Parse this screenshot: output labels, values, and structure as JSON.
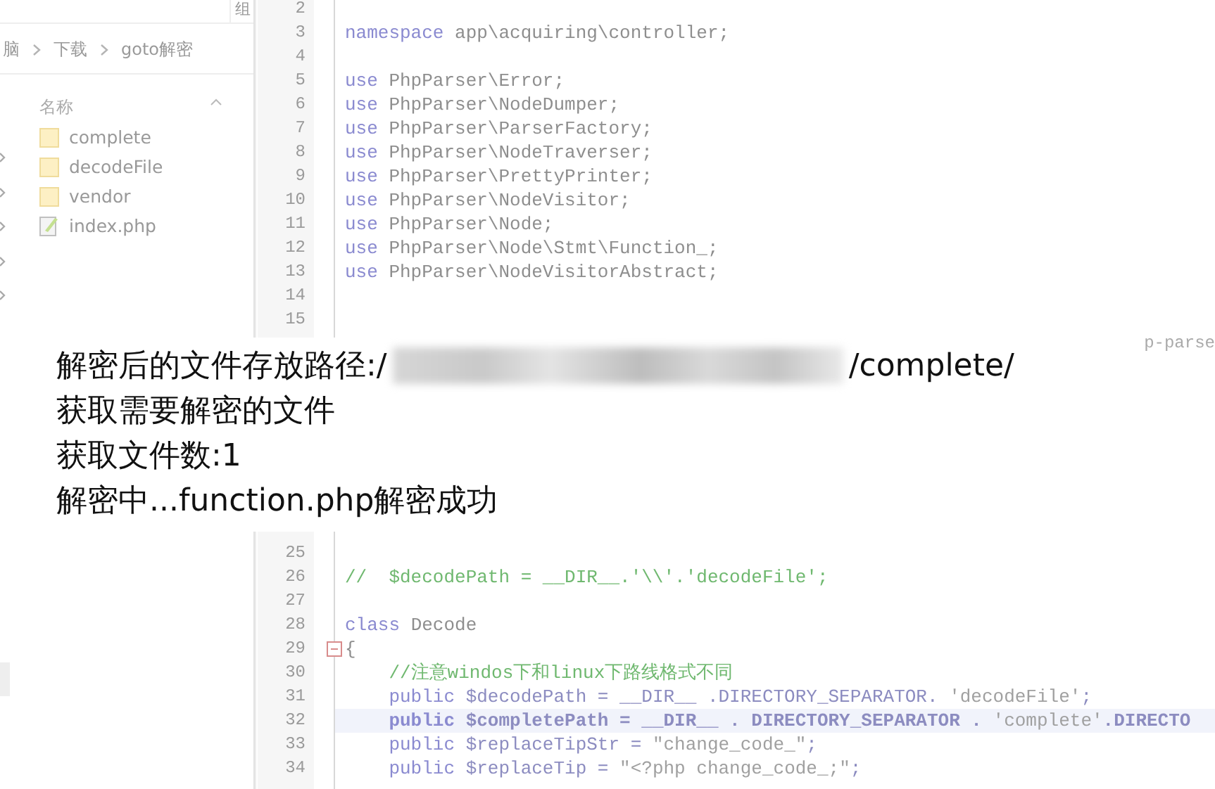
{
  "explorer": {
    "column_fragment": "组",
    "breadcrumb": [
      "脑",
      "下载",
      "goto解密"
    ],
    "column": "名称",
    "files": [
      {
        "name": "complete",
        "kind": "folder"
      },
      {
        "name": "decodeFile",
        "kind": "folder"
      },
      {
        "name": "vendor",
        "kind": "folder"
      },
      {
        "name": "index.php",
        "kind": "php"
      }
    ]
  },
  "editor": {
    "top_lines": [
      {
        "number": "2",
        "current": false,
        "fold": false
      },
      {
        "number": "3",
        "current": false,
        "fold": false,
        "tokens": [
          {
            "kind": "kw",
            "text": "namespace"
          },
          {
            "kind": "plain",
            "text": " app\\acquiring\\controller;"
          }
        ]
      },
      {
        "number": "4",
        "current": false,
        "fold": false
      },
      {
        "number": "5",
        "current": false,
        "fold": false,
        "tokens": [
          {
            "kind": "kw",
            "text": "use"
          },
          {
            "kind": "plain",
            "text": " PhpParser\\Error;"
          }
        ]
      },
      {
        "number": "6",
        "current": false,
        "fold": false,
        "tokens": [
          {
            "kind": "kw",
            "text": "use"
          },
          {
            "kind": "plain",
            "text": " PhpParser\\NodeDumper;"
          }
        ]
      },
      {
        "number": "7",
        "current": false,
        "fold": false,
        "tokens": [
          {
            "kind": "kw",
            "text": "use"
          },
          {
            "kind": "plain",
            "text": " PhpParser\\ParserFactory;"
          }
        ]
      },
      {
        "number": "8",
        "current": false,
        "fold": false,
        "tokens": [
          {
            "kind": "kw",
            "text": "use"
          },
          {
            "kind": "plain",
            "text": " PhpParser\\NodeTraverser;"
          }
        ]
      },
      {
        "number": "9",
        "current": false,
        "fold": false,
        "tokens": [
          {
            "kind": "kw",
            "text": "use"
          },
          {
            "kind": "plain",
            "text": " PhpParser\\PrettyPrinter;"
          }
        ]
      },
      {
        "number": "10",
        "current": false,
        "fold": false,
        "tokens": [
          {
            "kind": "kw",
            "text": "use"
          },
          {
            "kind": "plain",
            "text": " PhpParser\\NodeVisitor;"
          }
        ]
      },
      {
        "number": "11",
        "current": false,
        "fold": false,
        "tokens": [
          {
            "kind": "kw",
            "text": "use"
          },
          {
            "kind": "plain",
            "text": " PhpParser\\Node;"
          }
        ]
      },
      {
        "number": "12",
        "current": false,
        "fold": false,
        "tokens": [
          {
            "kind": "kw",
            "text": "use"
          },
          {
            "kind": "plain",
            "text": " PhpParser\\Node\\Stmt\\Function_;"
          }
        ]
      },
      {
        "number": "13",
        "current": false,
        "fold": false,
        "tokens": [
          {
            "kind": "kw",
            "text": "use"
          },
          {
            "kind": "plain",
            "text": " PhpParser\\NodeVisitorAbstract;"
          }
        ]
      },
      {
        "number": "14",
        "current": false,
        "fold": false
      },
      {
        "number": "15",
        "current": false,
        "fold": false
      }
    ],
    "fragment": "p-parse",
    "bottom_lines": [
      {
        "number": "25",
        "current": false,
        "fold": false
      },
      {
        "number": "26",
        "current": false,
        "fold": false,
        "tokens": [
          {
            "kind": "comment",
            "text": "//  $decodePath = __DIR__.'\\\\'.'decodeFile';"
          }
        ]
      },
      {
        "number": "27",
        "current": false,
        "fold": false
      },
      {
        "number": "28",
        "current": false,
        "fold": false,
        "tokens": [
          {
            "kind": "kw",
            "text": "class"
          },
          {
            "kind": "plain",
            "text": " Decode"
          }
        ]
      },
      {
        "number": "29",
        "current": false,
        "fold": true,
        "tokens": [
          {
            "kind": "plain",
            "text": "{"
          }
        ]
      },
      {
        "number": "30",
        "current": false,
        "fold": false,
        "tokens": [
          {
            "kind": "comment",
            "text": "    //注意windos下和linux下路线格式不同"
          }
        ]
      },
      {
        "number": "31",
        "current": false,
        "fold": false,
        "tokens": [
          {
            "kind": "kw",
            "text": "    public"
          },
          {
            "kind": "var",
            "text": " $decodePath = __DIR__ .DIRECTORY_SEPARATOR. "
          },
          {
            "kind": "str",
            "text": "'decodeFile'"
          },
          {
            "kind": "var",
            "text": ";"
          }
        ]
      },
      {
        "number": "32",
        "current": true,
        "fold": false,
        "tokens": [
          {
            "kind": "kw",
            "text": "    public"
          },
          {
            "kind": "var",
            "text": " $completePath = __DIR__ . DIRECTORY_SEPARATOR . "
          },
          {
            "kind": "str",
            "text": "'complete'"
          },
          {
            "kind": "var",
            "text": ".DIRECTO"
          }
        ]
      },
      {
        "number": "33",
        "current": false,
        "fold": false,
        "tokens": [
          {
            "kind": "kw",
            "text": "    public"
          },
          {
            "kind": "var",
            "text": " $replaceTipStr = "
          },
          {
            "kind": "str",
            "text": "\"change_code_\""
          },
          {
            "kind": "var",
            "text": ";"
          }
        ]
      },
      {
        "number": "34",
        "current": false,
        "fold": false,
        "tokens": [
          {
            "kind": "kw",
            "text": "    public"
          },
          {
            "kind": "var",
            "text": " $replaceTip = "
          },
          {
            "kind": "str",
            "text": "\"<?php change_code_;\""
          },
          {
            "kind": "var",
            "text": ";"
          }
        ]
      }
    ]
  },
  "console": {
    "lines": [
      {
        "parts": [
          {
            "kind": "text",
            "text": "解密后的文件存放路径:/"
          },
          {
            "kind": "redacted"
          },
          {
            "kind": "text",
            "text": "/complete/"
          }
        ]
      },
      {
        "parts": [
          {
            "kind": "text",
            "text": "获取需要解密的文件"
          }
        ]
      },
      {
        "parts": [
          {
            "kind": "text",
            "text": "获取文件数:1"
          }
        ]
      },
      {
        "parts": [
          {
            "kind": "text",
            "text": "解密中...function.php解密成功"
          }
        ]
      }
    ]
  }
}
